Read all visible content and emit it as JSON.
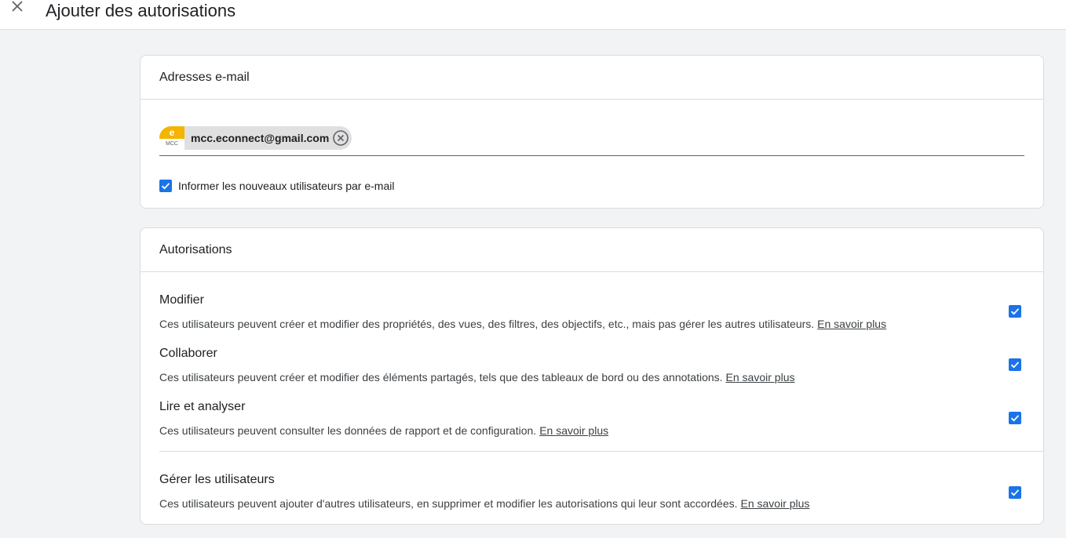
{
  "header": {
    "title": "Ajouter des autorisations",
    "close_icon": "close-icon"
  },
  "email_section": {
    "title": "Adresses e-mail",
    "chip": {
      "avatar_letter": "e",
      "avatar_sub": "MCC",
      "email": "mcc.econnect@gmail.com",
      "remove_icon": "cancel-circle-icon"
    },
    "notify": {
      "label": "Informer les nouveaux utilisateurs par e-mail",
      "checked": true
    }
  },
  "permissions_section": {
    "title": "Autorisations",
    "items": [
      {
        "title": "Modifier",
        "description": "Ces utilisateurs peuvent créer et modifier des propriétés, des vues, des filtres, des objectifs, etc., mais pas gérer les autres utilisateurs.",
        "link": "En savoir plus",
        "checked": true
      },
      {
        "title": "Collaborer",
        "description": "Ces utilisateurs peuvent créer et modifier des éléments partagés, tels que des tableaux de bord ou des annotations.",
        "link": "En savoir plus",
        "checked": true
      },
      {
        "title": "Lire et analyser",
        "description": "Ces utilisateurs peuvent consulter les données de rapport et de configuration.",
        "link": "En savoir plus",
        "checked": true
      },
      {
        "title": "Gérer les utilisateurs",
        "description": "Ces utilisateurs peuvent ajouter d'autres utilisateurs, en supprimer et modifier les autorisations qui leur sont accordées.",
        "link": "En savoir plus",
        "checked": true
      }
    ]
  },
  "colors": {
    "accent": "#1a73e8",
    "avatar": "#f4b400",
    "background": "#f1f3f4"
  }
}
